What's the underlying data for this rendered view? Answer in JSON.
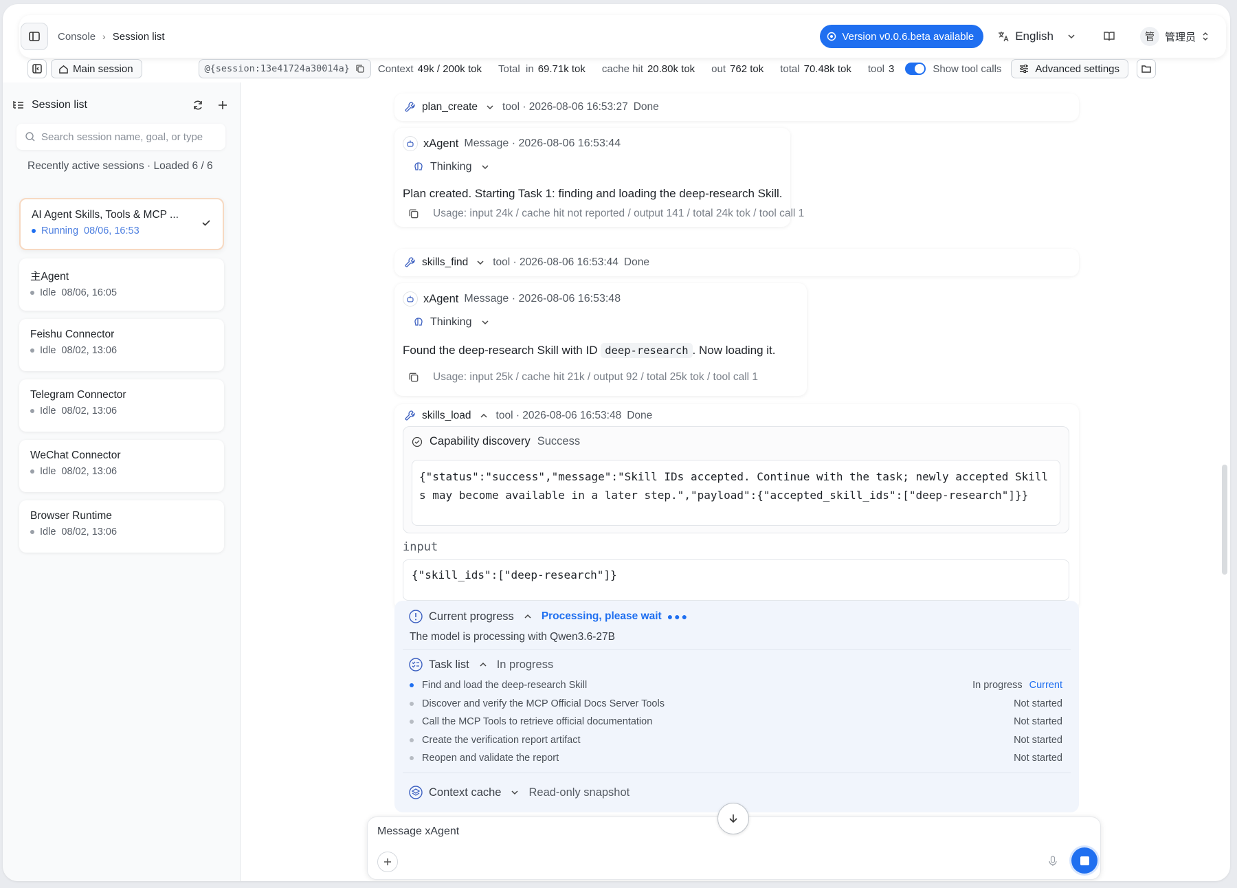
{
  "topbar": {
    "breadcrumb_root": "Console",
    "breadcrumb_current": "Session list",
    "version_label": "Version v0.0.6.beta available",
    "language": "English",
    "user_avatar": "管",
    "user_name": "管理员"
  },
  "session_bar": {
    "main_session_label": "Main session",
    "session_id": "@{session:13e41724a30014a}",
    "stats": [
      {
        "label": "Context",
        "value": "49k / 200k tok"
      },
      {
        "label": "Total  in",
        "value": "69.71k tok"
      },
      {
        "label": "cache hit",
        "value": "20.80k tok"
      },
      {
        "label": "out",
        "value": "762 tok"
      },
      {
        "label": "total",
        "value": "70.48k tok"
      },
      {
        "label": "tool",
        "value": "3"
      }
    ],
    "show_tool_calls_label": "Show tool calls",
    "show_tool_calls_on": true,
    "advanced_label": "Advanced settings"
  },
  "sidebar": {
    "title": "Session list",
    "search_placeholder": "Search session name, goal, or type",
    "recent_text": "Recently active sessions · Loaded 6 / 6",
    "sessions": [
      {
        "name": "AI Agent Skills, Tools & MCP ...",
        "status": "Running",
        "time": "08/06, 16:53",
        "active": true
      },
      {
        "name": "主Agent",
        "status": "Idle",
        "time": "08/06, 16:05"
      },
      {
        "name": "Feishu Connector",
        "status": "Idle",
        "time": "08/02, 13:06"
      },
      {
        "name": "Telegram Connector",
        "status": "Idle",
        "time": "08/02, 13:06"
      },
      {
        "name": "WeChat Connector",
        "status": "Idle",
        "time": "08/02, 13:06"
      },
      {
        "name": "Browser Runtime",
        "status": "Idle",
        "time": "08/02, 13:06"
      }
    ]
  },
  "chat": {
    "tool1": {
      "name": "plan_create",
      "meta": "tool · 2026-08-06 16:53:27",
      "state": "Done"
    },
    "msg1": {
      "agent": "xAgent",
      "meta": "Message · 2026-08-06 16:53:44",
      "thinking": "Thinking",
      "text": "Plan created. Starting Task 1: finding and loading the deep-research Skill.",
      "usage": "Usage: input 24k / cache hit not reported / output 141 / total 24k tok / tool call 1"
    },
    "tool2": {
      "name": "skills_find",
      "meta": "tool · 2026-08-06 16:53:44",
      "state": "Done"
    },
    "msg2": {
      "agent": "xAgent",
      "meta": "Message · 2026-08-06 16:53:48",
      "thinking": "Thinking",
      "text_before": "Found the deep-research Skill with ID",
      "code": "deep-research",
      "text_after": ". Now loading it.",
      "usage": "Usage: input 25k / cache hit 21k / output 92 / total 25k tok / tool call 1"
    },
    "tool3": {
      "name": "skills_load",
      "meta": "tool · 2026-08-06 16:53:48",
      "state": "Done",
      "cap_title": "Capability discovery",
      "cap_status": "Success",
      "output_json": "{\"status\":\"success\",\"message\":\"Skill IDs accepted. Continue with the task; newly accepted Skills may become available in a later step.\",\"payload\":{\"accepted_skill_ids\":[\"deep-research\"]}}",
      "input_label": "input",
      "input_json": "{\"skill_ids\":[\"deep-research\"]}"
    },
    "progress": {
      "title": "Current progress",
      "processing": "Processing, please wait",
      "subtitle": "The model is processing with Qwen3.6-27B",
      "task_title": "Task list",
      "task_status": "In progress",
      "tasks": [
        {
          "text": "Find and load the deep-research Skill",
          "status": "In progress",
          "current": "Current"
        },
        {
          "text": "Discover and verify the MCP Official Docs Server Tools",
          "status": "Not started"
        },
        {
          "text": "Call the MCP Tools to retrieve official documentation",
          "status": "Not started"
        },
        {
          "text": "Create the verification report artifact",
          "status": "Not started"
        },
        {
          "text": "Reopen and validate the report",
          "status": "Not started"
        }
      ],
      "ctx_title": "Context cache",
      "ctx_status": "Read-only snapshot"
    },
    "composer_placeholder": "Message xAgent"
  },
  "colors": {
    "accent": "#1f6ff0",
    "active_border": "#f7d9c2"
  }
}
